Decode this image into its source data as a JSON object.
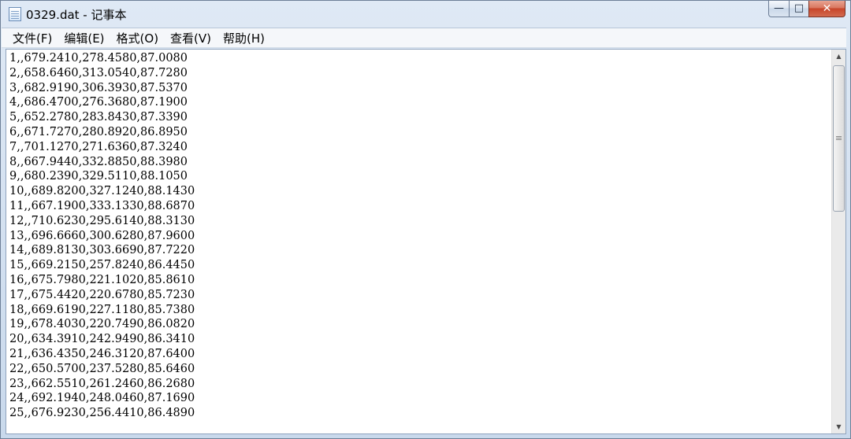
{
  "window": {
    "title": "0329.dat - 记事本"
  },
  "caption": {
    "minimize": "—",
    "maximize": "□",
    "close": "✕"
  },
  "menu": {
    "items": [
      {
        "label": "文件(F)"
      },
      {
        "label": "编辑(E)"
      },
      {
        "label": "格式(O)"
      },
      {
        "label": "查看(V)"
      },
      {
        "label": "帮助(H)"
      }
    ]
  },
  "editor": {
    "content": "1,,679.2410,278.4580,87.0080\n2,,658.6460,313.0540,87.7280\n3,,682.9190,306.3930,87.5370\n4,,686.4700,276.3680,87.1900\n5,,652.2780,283.8430,87.3390\n6,,671.7270,280.8920,86.8950\n7,,701.1270,271.6360,87.3240\n8,,667.9440,332.8850,88.3980\n9,,680.2390,329.5110,88.1050\n10,,689.8200,327.1240,88.1430\n11,,667.1900,333.1330,88.6870\n12,,710.6230,295.6140,88.3130\n13,,696.6660,300.6280,87.9600\n14,,689.8130,303.6690,87.7220\n15,,669.2150,257.8240,86.4450\n16,,675.7980,221.1020,85.8610\n17,,675.4420,220.6780,85.7230\n18,,669.6190,227.1180,85.7380\n19,,678.4030,220.7490,86.0820\n20,,634.3910,242.9490,86.3410\n21,,636.4350,246.3120,87.6400\n22,,650.5700,237.5280,85.6460\n23,,662.5510,261.2460,86.2680\n24,,692.1940,248.0460,87.1690\n25,,676.9230,256.4410,86.4890"
  },
  "scrollbar": {
    "up_arrow": "▲",
    "down_arrow": "▼"
  }
}
